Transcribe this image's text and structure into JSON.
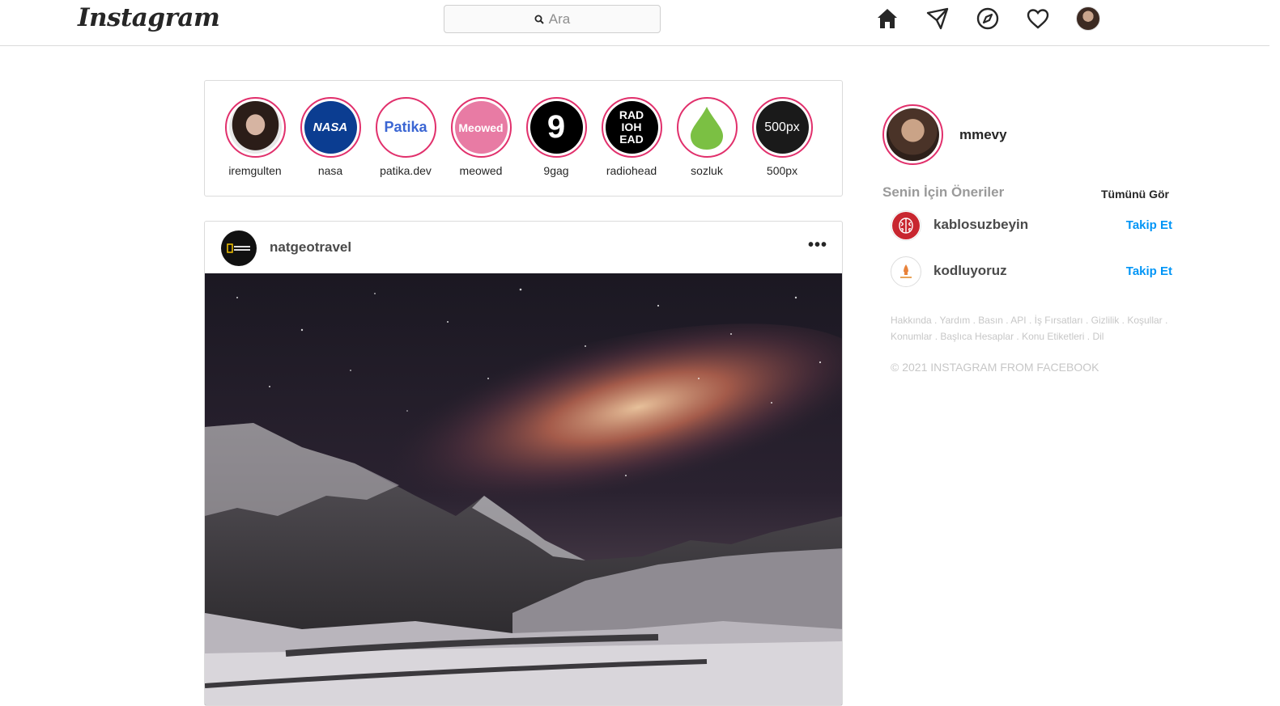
{
  "header": {
    "logo": "Instagram",
    "search_placeholder": "Ara",
    "nav_icons": [
      "home-icon",
      "direct-message-icon",
      "explore-icon",
      "activity-heart-icon",
      "profile-avatar"
    ]
  },
  "stories": [
    {
      "name": "iremgulten",
      "label_on_pic": ""
    },
    {
      "name": "nasa",
      "label_on_pic": "NASA"
    },
    {
      "name": "patika.dev",
      "label_on_pic": "Patika"
    },
    {
      "name": "meowed",
      "label_on_pic": "Meowed"
    },
    {
      "name": "9gag",
      "label_on_pic": "9"
    },
    {
      "name": "radiohead",
      "label_on_pic": "RAD IOH EAD"
    },
    {
      "name": "sozluk",
      "label_on_pic": ""
    },
    {
      "name": "500px",
      "label_on_pic": "500px"
    }
  ],
  "post": {
    "username": "natgeotravel",
    "more": "•••"
  },
  "sidebar": {
    "username": "mmevy",
    "suggestions_title": "Senin İçin Öneriler",
    "see_all": "Tümünü Gör",
    "suggestions": [
      {
        "name": "kablosuzbeyin",
        "action": "Takip Et"
      },
      {
        "name": "kodluyoruz",
        "action": "Takip Et"
      }
    ],
    "footer_links": "Hakkında . Yardım . Basın . API . İş Fırsatları . Gizlilik . Koşullar . Konumlar . Başlıca Hesaplar . Konu Etiketleri . Dil",
    "copyright": "© 2021 INSTAGRAM FROM FACEBOOK"
  },
  "colors": {
    "story_ring": "#e1306c",
    "follow_blue": "#0095f6",
    "border": "#dbdbdb"
  }
}
